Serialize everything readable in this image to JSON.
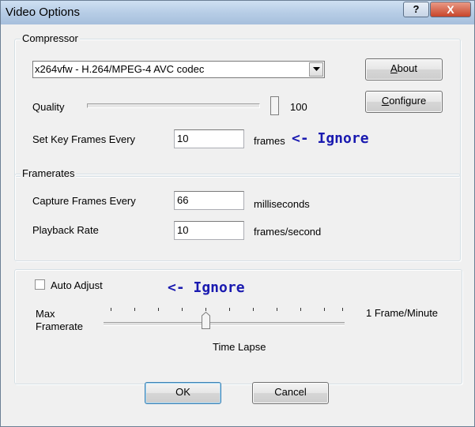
{
  "window": {
    "title": "Video Options",
    "help_glyph": "?",
    "close_glyph": "X"
  },
  "compressor": {
    "group_label": "Compressor",
    "codec_selected": "x264vfw - H.264/MPEG-4 AVC codec",
    "about_label": "About",
    "about_accel": "A",
    "configure_label": "Configure",
    "configure_accel": "C",
    "quality_label": "Quality",
    "quality_value": "100",
    "quality_level": 1.0,
    "keyframes_label": "Set Key Frames Every",
    "keyframes_value": "10",
    "keyframes_unit": "frames",
    "annotation": "<- Ignore"
  },
  "framerates": {
    "group_label": "Framerates",
    "capture_label": "Capture Frames Every",
    "capture_value": "66",
    "capture_unit": "milliseconds",
    "playback_label": "Playback Rate",
    "playback_value": "10",
    "playback_unit": "frames/second"
  },
  "auto_adjust": {
    "checkbox_label": "Auto Adjust",
    "checked": false,
    "annotation": "<- Ignore",
    "max_label_line1": "Max",
    "max_label_line2": "Framerate",
    "right_label": "1 Frame/Minute",
    "bottom_label": "Time Lapse"
  },
  "buttons": {
    "ok_label": "OK",
    "cancel_label": "Cancel"
  },
  "icons": {
    "dropdown": "chevron-down-icon",
    "help": "help-icon",
    "close": "close-icon"
  },
  "colors": {
    "annotation": "#1a1ab0",
    "close_button": "#c7452a"
  }
}
